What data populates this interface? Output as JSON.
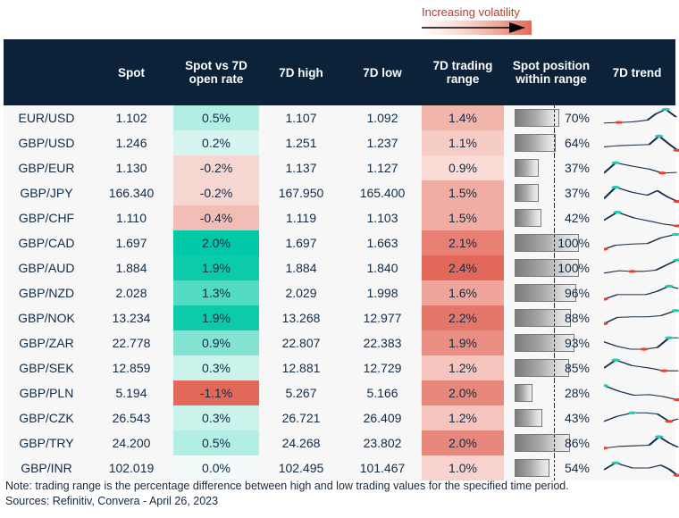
{
  "legend": {
    "label": "Increasing volatility",
    "gradient_from": "#ffffff",
    "gradient_to": "#e26a57"
  },
  "table": {
    "headers": {
      "pair": "",
      "spot": "Spot",
      "change": "Spot vs 7D open rate",
      "high": "7D high",
      "low": "7D low",
      "range": "7D trading range",
      "position": "Spot position within range",
      "trend": "7D trend"
    },
    "rows": [
      {
        "pair": "EUR/USD",
        "spot": "1.102",
        "change": "0.5%",
        "change_val": 0.5,
        "high": "1.107",
        "low": "1.092",
        "range": "1.4%",
        "range_val": 1.4,
        "position": "70%",
        "position_val": 70
      },
      {
        "pair": "GBP/USD",
        "spot": "1.246",
        "change": "0.2%",
        "change_val": 0.2,
        "high": "1.251",
        "low": "1.237",
        "range": "1.1%",
        "range_val": 1.1,
        "position": "64%",
        "position_val": 64
      },
      {
        "pair": "GBP/EUR",
        "spot": "1.130",
        "change": "-0.2%",
        "change_val": -0.2,
        "high": "1.137",
        "low": "1.127",
        "range": "0.9%",
        "range_val": 0.9,
        "position": "37%",
        "position_val": 37
      },
      {
        "pair": "GBP/JPY",
        "spot": "166.340",
        "change": "-0.2%",
        "change_val": -0.2,
        "high": "167.950",
        "low": "165.400",
        "range": "1.5%",
        "range_val": 1.5,
        "position": "37%",
        "position_val": 37
      },
      {
        "pair": "GBP/CHF",
        "spot": "1.110",
        "change": "-0.4%",
        "change_val": -0.4,
        "high": "1.119",
        "low": "1.103",
        "range": "1.5%",
        "range_val": 1.5,
        "position": "42%",
        "position_val": 42
      },
      {
        "pair": "GBP/CAD",
        "spot": "1.697",
        "change": "2.0%",
        "change_val": 2.0,
        "high": "1.697",
        "low": "1.663",
        "range": "2.1%",
        "range_val": 2.1,
        "position": "100%",
        "position_val": 100
      },
      {
        "pair": "GBP/AUD",
        "spot": "1.884",
        "change": "1.9%",
        "change_val": 1.9,
        "high": "1.884",
        "low": "1.840",
        "range": "2.4%",
        "range_val": 2.4,
        "position": "100%",
        "position_val": 100
      },
      {
        "pair": "GBP/NZD",
        "spot": "2.028",
        "change": "1.3%",
        "change_val": 1.3,
        "high": "2.029",
        "low": "1.998",
        "range": "1.6%",
        "range_val": 1.6,
        "position": "96%",
        "position_val": 96
      },
      {
        "pair": "GBP/NOK",
        "spot": "13.234",
        "change": "1.9%",
        "change_val": 1.9,
        "high": "13.268",
        "low": "12.977",
        "range": "2.2%",
        "range_val": 2.2,
        "position": "88%",
        "position_val": 88
      },
      {
        "pair": "GBP/ZAR",
        "spot": "22.778",
        "change": "0.9%",
        "change_val": 0.9,
        "high": "22.807",
        "low": "22.383",
        "range": "1.9%",
        "range_val": 1.9,
        "position": "93%",
        "position_val": 93
      },
      {
        "pair": "GBP/SEK",
        "spot": "12.859",
        "change": "0.3%",
        "change_val": 0.3,
        "high": "12.881",
        "low": "12.729",
        "range": "1.2%",
        "range_val": 1.2,
        "position": "85%",
        "position_val": 85
      },
      {
        "pair": "GBP/PLN",
        "spot": "5.194",
        "change": "-1.1%",
        "change_val": -1.1,
        "high": "5.267",
        "low": "5.166",
        "range": "2.0%",
        "range_val": 2.0,
        "position": "28%",
        "position_val": 28
      },
      {
        "pair": "GBP/CZK",
        "spot": "26.543",
        "change": "0.3%",
        "change_val": 0.3,
        "high": "26.721",
        "low": "26.409",
        "range": "1.2%",
        "range_val": 1.2,
        "position": "43%",
        "position_val": 43
      },
      {
        "pair": "GBP/TRY",
        "spot": "24.200",
        "change": "0.5%",
        "change_val": 0.5,
        "high": "24.268",
        "low": "23.802",
        "range": "2.0%",
        "range_val": 2.0,
        "position": "86%",
        "position_val": 86
      },
      {
        "pair": "GBP/INR",
        "spot": "102.019",
        "change": "0.0%",
        "change_val": 0.0,
        "high": "102.495",
        "low": "101.467",
        "range": "1.0%",
        "range_val": 1.0,
        "position": "54%",
        "position_val": 54
      }
    ]
  },
  "sparklines": [
    {
      "pair": "EUR/USD",
      "points": [
        [
          0,
          62
        ],
        [
          18,
          60
        ],
        [
          34,
          58
        ],
        [
          52,
          52
        ],
        [
          62,
          30
        ],
        [
          74,
          14
        ],
        [
          86,
          40
        ]
      ],
      "low_index": 1,
      "high_index": 5
    },
    {
      "pair": "GBP/USD",
      "points": [
        [
          0,
          58
        ],
        [
          16,
          54
        ],
        [
          34,
          52
        ],
        [
          54,
          50
        ],
        [
          66,
          20
        ],
        [
          78,
          48
        ],
        [
          88,
          70
        ]
      ],
      "low_index": 6,
      "high_index": 4
    },
    {
      "pair": "GBP/EUR",
      "points": [
        [
          0,
          62
        ],
        [
          14,
          26
        ],
        [
          34,
          38
        ],
        [
          54,
          48
        ],
        [
          70,
          62
        ],
        [
          86,
          60
        ]
      ],
      "low_index": 4,
      "high_index": 1
    },
    {
      "pair": "GBP/JPY",
      "points": [
        [
          0,
          64
        ],
        [
          14,
          24
        ],
        [
          34,
          42
        ],
        [
          52,
          52
        ],
        [
          64,
          36
        ],
        [
          76,
          58
        ],
        [
          88,
          74
        ]
      ],
      "low_index": 6,
      "high_index": 1
    },
    {
      "pair": "GBP/CHF",
      "points": [
        [
          0,
          52
        ],
        [
          16,
          24
        ],
        [
          36,
          44
        ],
        [
          56,
          56
        ],
        [
          72,
          66
        ],
        [
          88,
          72
        ]
      ],
      "low_index": 5,
      "high_index": 1
    },
    {
      "pair": "GBP/CAD",
      "points": [
        [
          0,
          66
        ],
        [
          14,
          52
        ],
        [
          34,
          48
        ],
        [
          52,
          46
        ],
        [
          68,
          26
        ],
        [
          86,
          14
        ]
      ],
      "low_index": 0,
      "high_index": 5
    },
    {
      "pair": "GBP/AUD",
      "points": [
        [
          0,
          62
        ],
        [
          18,
          54
        ],
        [
          34,
          56
        ],
        [
          48,
          56
        ],
        [
          62,
          52
        ],
        [
          76,
          32
        ],
        [
          88,
          16
        ]
      ],
      "low_index": 2,
      "high_index": 6
    },
    {
      "pair": "GBP/NZD",
      "points": [
        [
          0,
          66
        ],
        [
          16,
          50
        ],
        [
          34,
          50
        ],
        [
          50,
          50
        ],
        [
          64,
          38
        ],
        [
          78,
          20
        ],
        [
          88,
          28
        ]
      ],
      "low_index": 0,
      "high_index": 5
    },
    {
      "pair": "GBP/NOK",
      "points": [
        [
          0,
          64
        ],
        [
          16,
          42
        ],
        [
          34,
          40
        ],
        [
          52,
          40
        ],
        [
          68,
          36
        ],
        [
          86,
          18
        ]
      ],
      "low_index": 0,
      "high_index": 5
    },
    {
      "pair": "GBP/ZAR",
      "points": [
        [
          0,
          40
        ],
        [
          16,
          56
        ],
        [
          32,
          66
        ],
        [
          48,
          66
        ],
        [
          64,
          60
        ],
        [
          78,
          26
        ],
        [
          88,
          26
        ]
      ],
      "low_index": 3,
      "high_index": 5
    },
    {
      "pair": "GBP/SEK",
      "points": [
        [
          0,
          44
        ],
        [
          14,
          16
        ],
        [
          34,
          36
        ],
        [
          54,
          44
        ],
        [
          72,
          54
        ],
        [
          88,
          54
        ]
      ],
      "low_index": 4,
      "high_index": 1
    },
    {
      "pair": "GBP/PLN",
      "points": [
        [
          0,
          18
        ],
        [
          18,
          38
        ],
        [
          36,
          52
        ],
        [
          54,
          50
        ],
        [
          70,
          56
        ],
        [
          88,
          68
        ]
      ],
      "low_index": 5,
      "high_index": 0
    },
    {
      "pair": "GBP/CZK",
      "points": [
        [
          0,
          56
        ],
        [
          16,
          38
        ],
        [
          34,
          26
        ],
        [
          50,
          26
        ],
        [
          64,
          30
        ],
        [
          78,
          56
        ],
        [
          88,
          48
        ]
      ],
      "low_index": 5,
      "high_index": 2
    },
    {
      "pair": "GBP/TRY",
      "points": [
        [
          0,
          62
        ],
        [
          18,
          56
        ],
        [
          36,
          54
        ],
        [
          54,
          52
        ],
        [
          66,
          22
        ],
        [
          78,
          44
        ],
        [
          88,
          58
        ]
      ],
      "low_index": 0,
      "high_index": 4
    },
    {
      "pair": "GBP/INR",
      "points": [
        [
          0,
          50
        ],
        [
          14,
          26
        ],
        [
          34,
          44
        ],
        [
          54,
          44
        ],
        [
          68,
          34
        ],
        [
          78,
          48
        ],
        [
          88,
          70
        ]
      ],
      "low_index": 6,
      "high_index": 1
    }
  ],
  "notes": {
    "line1": "Note: trading range is the percentage difference between high and low trading values for the specified time period.",
    "line2": "Sources: Refinitiv, Convera - April 26, 2023"
  },
  "colors": {
    "header_bg": "#0b2239",
    "text": "#122b45",
    "positive_strong": "#00c9a7",
    "positive_weak": "#d8f3ef",
    "negative_strong": "#e2685a",
    "negative_weak": "#fae4e0",
    "range_low": "#fadbd5",
    "range_high": "#e2685a",
    "spark_line": "#16304a",
    "spark_high": "#17d1b0",
    "spark_low": "#e8412f",
    "bar_border": "#7b7b7b"
  }
}
